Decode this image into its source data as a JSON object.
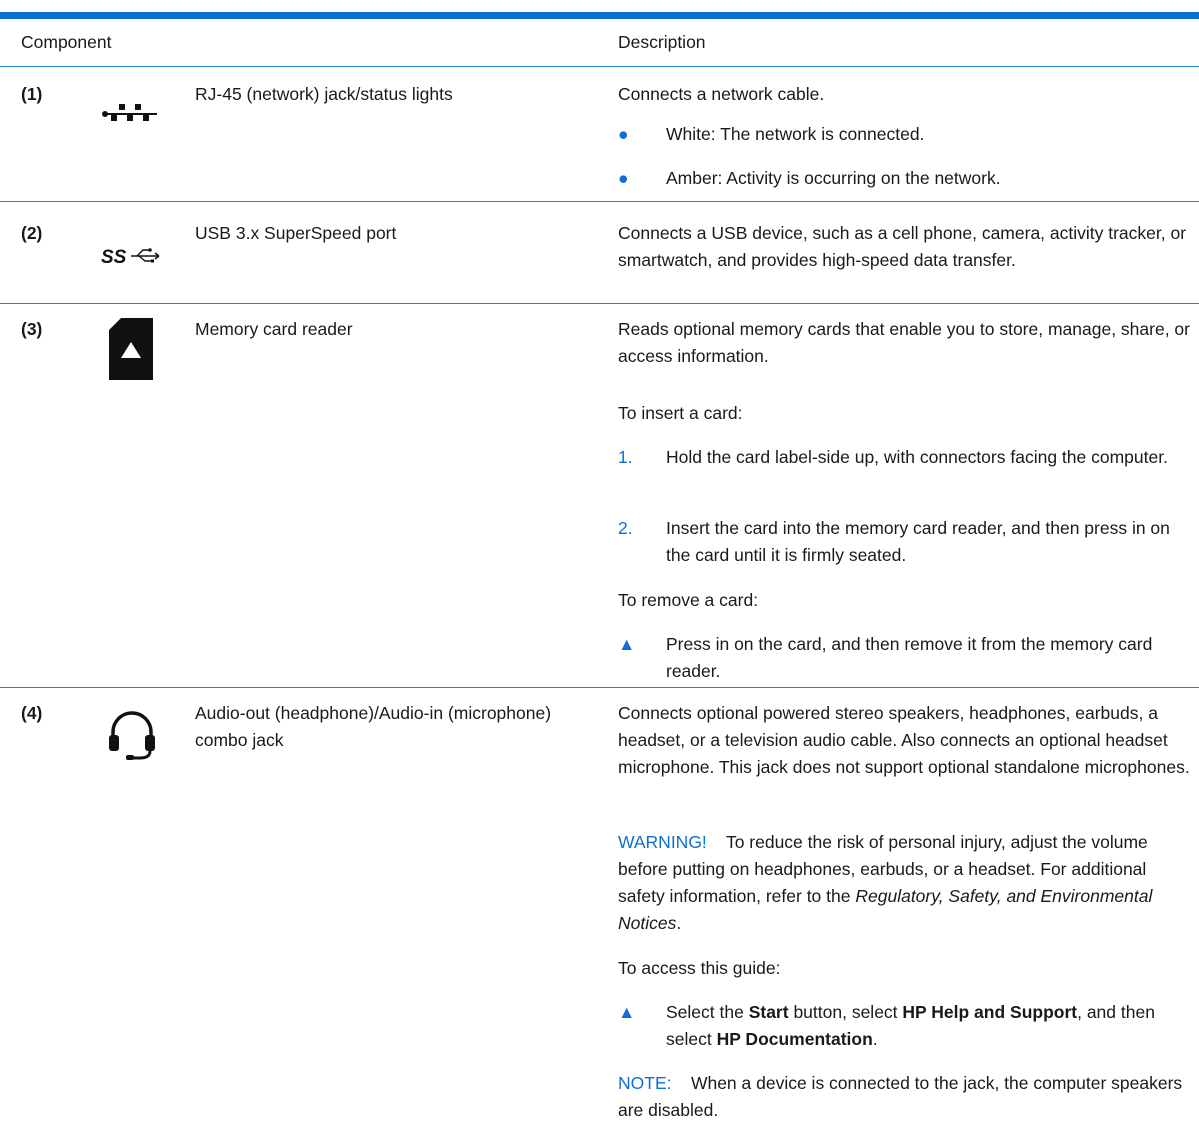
{
  "header": {
    "component": "Component",
    "description": "Description"
  },
  "rows": [
    {
      "num": "(1)",
      "icon": "rj45-network-icon",
      "component": "RJ-45 (network) jack/status lights",
      "desc": "Connects a network cable.",
      "bullets": [
        "White: The network is connected.",
        "Amber: Activity is occurring on the network."
      ]
    },
    {
      "num": "(2)",
      "icon": "usb-superspeed-icon",
      "component": "USB 3.x SuperSpeed port",
      "desc": "Connects a USB device, such as a cell phone, camera, activity tracker, or smartwatch, and provides high-speed data transfer."
    },
    {
      "num": "(3)",
      "icon": "memory-card-icon",
      "component": "Memory card reader",
      "desc": "Reads optional memory cards that enable you to store, manage, share, or access information.",
      "insert_title": "To insert a card:",
      "steps": [
        {
          "n": "1.",
          "text": "Hold the card label-side up, with connectors facing the computer."
        },
        {
          "n": "2.",
          "text": "Insert the card into the memory card reader, and then press in on the card until it is firmly seated."
        }
      ],
      "remove_title": "To remove a card:",
      "remove_step": "Press in on the card, and then remove it from the memory card reader."
    },
    {
      "num": "(4)",
      "icon": "headset-icon",
      "component": "Audio-out (headphone)/Audio-in (microphone) combo jack",
      "desc": "Connects optional powered stereo speakers, headphones, earbuds, a headset, or a television audio cable. Also connects an optional headset microphone. This jack does not support optional standalone microphones.",
      "warning_label": "WARNING!",
      "warning_text": "To reduce the risk of personal injury, adjust the volume before putting on headphones, earbuds, or a headset. For additional safety information, refer to the",
      "warning_doc": "Regulatory, Safety, and Environmental Notices",
      "warning_end": ".",
      "access_title": "To access this guide:",
      "access": {
        "p1": "Select the ",
        "start": "Start",
        "p2": " button, select ",
        "help": "HP Help and Support",
        "p3": ", and then select ",
        "doc": "HP Documentation",
        "p4": "."
      },
      "note_label": "NOTE:",
      "note_text": "When a device is connected to the jack, the computer speakers are disabled."
    }
  ],
  "glyphs": {
    "bullet": "●",
    "triangle": "▲"
  },
  "colors": {
    "accent": "#0d6fd6",
    "rule": "#2a7fd9",
    "text": "#1a1a1a"
  }
}
